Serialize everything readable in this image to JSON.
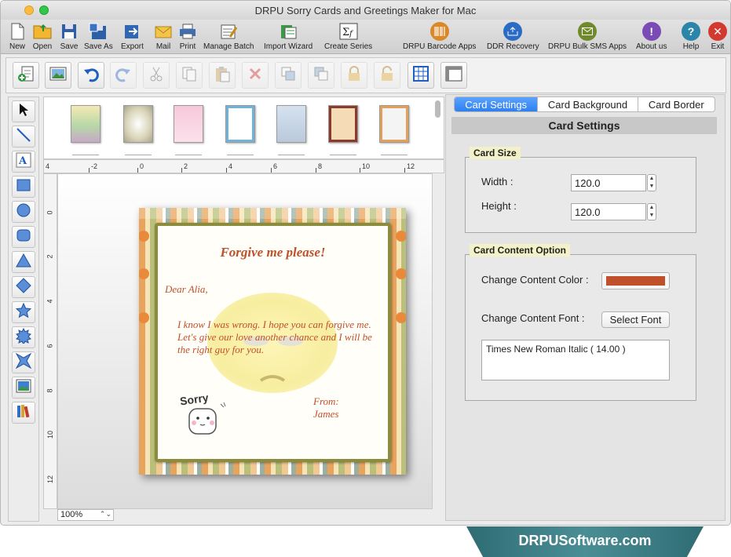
{
  "window": {
    "title": "DRPU Sorry Cards and Greetings Maker for Mac"
  },
  "main_toolbar": {
    "new": "New",
    "open": "Open",
    "save": "Save",
    "save_as": "Save As",
    "export": "Export",
    "mail": "Mail",
    "print": "Print",
    "manage_batch": "Manage Batch",
    "import_wizard": "Import Wizard",
    "create_series": "Create Series",
    "barcode_apps": "DRPU Barcode Apps",
    "ddr_recovery": "DDR Recovery",
    "bulk_sms": "DRPU Bulk SMS Apps",
    "about": "About us",
    "help": "Help",
    "exit": "Exit"
  },
  "ruler": {
    "top_ticks": [
      "4",
      "-2",
      "0",
      "2",
      "4",
      "6",
      "8",
      "10",
      "12"
    ],
    "left_ticks": [
      "0",
      "2",
      "4",
      "6",
      "8",
      "10",
      "12"
    ]
  },
  "zoom": {
    "value": "100%"
  },
  "card": {
    "title": "Forgive me please!",
    "greeting": "Dear Alia,",
    "body": "I know I was wrong. I hope you can forgive me. Let's give our love another chance and I will be the right guy for you.",
    "from_label": "From:",
    "from_name": "James",
    "sticker_text": "Sorry"
  },
  "tabs": [
    "Card Settings",
    "Card Background",
    "Card Border"
  ],
  "card_settings": {
    "header": "Card Settings",
    "size_group": "Card Size",
    "width_label": "Width :",
    "width_value": "120.0",
    "height_label": "Height :",
    "height_value": "120.0",
    "content_group": "Card Content Option",
    "content_color_label": "Change Content Color :",
    "content_color": "#c0502a",
    "content_font_label": "Change Content Font :",
    "select_font": "Select Font",
    "font_value": "Times New Roman Italic ( 14.00 )"
  },
  "footer": {
    "brand": "DRPUSoftware.com"
  }
}
